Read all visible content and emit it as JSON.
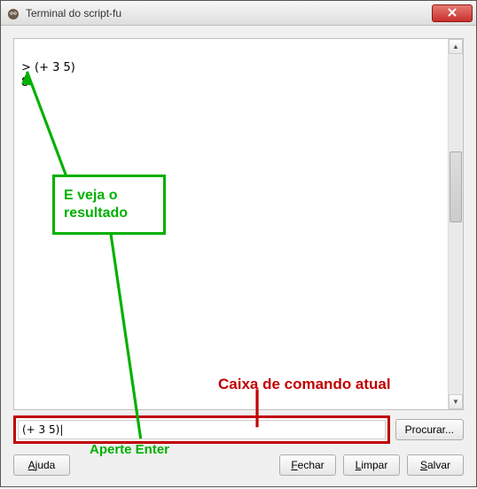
{
  "window": {
    "title": "Terminal do script-fu"
  },
  "console": {
    "prompt_line": "> (+ 3 5)",
    "result_line": "8"
  },
  "input": {
    "value": "(+ 3 5)|",
    "browse_label": "Procurar..."
  },
  "buttons": {
    "help": "Ajuda",
    "close": "Fechar",
    "clear": "Limpar",
    "save": "Salvar"
  },
  "annotations": {
    "result_box_line1": "E veja o",
    "result_box_line2": "resultado",
    "command_box_label": "Caixa de comando atual",
    "press_enter_label": "Aperte Enter"
  }
}
